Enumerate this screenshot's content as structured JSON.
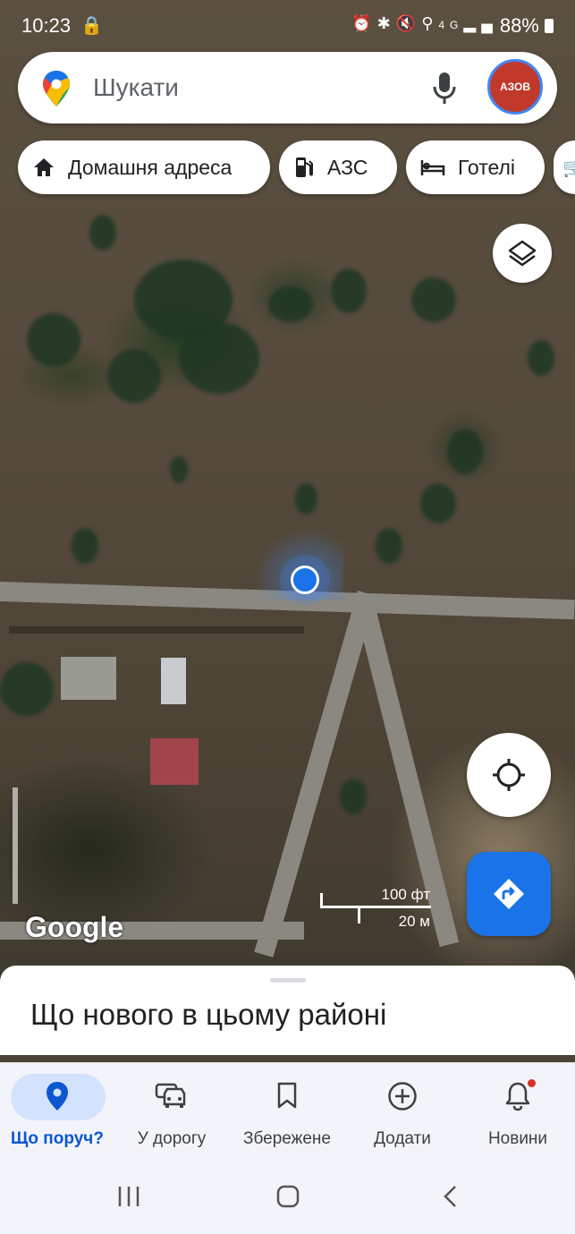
{
  "status_bar": {
    "time": "10:23",
    "battery": "88%",
    "icons": [
      "alarm-icon",
      "bluetooth-icon",
      "mute-icon",
      "location-icon",
      "4g-icon",
      "signal-icon",
      "battery-icon"
    ]
  },
  "search": {
    "placeholder": "Шукати",
    "avatar_text": "АЗОВ"
  },
  "chips": [
    {
      "label": "Домашня адреса",
      "icon": "home-icon"
    },
    {
      "label": "АЗС",
      "icon": "gas-station-icon"
    },
    {
      "label": "Готелі",
      "icon": "hotel-icon"
    }
  ],
  "map": {
    "scale_imperial": "100 фт",
    "scale_metric": "20 м",
    "attribution": "Google"
  },
  "sheet": {
    "title": "Що нового в цьому районі"
  },
  "bottom_nav": [
    {
      "label": "Що поруч?",
      "icon": "place-pin-icon",
      "active": true
    },
    {
      "label": "У дорогу",
      "icon": "car-icon",
      "active": false
    },
    {
      "label": "Збережене",
      "icon": "bookmark-icon",
      "active": false
    },
    {
      "label": "Додати",
      "icon": "add-circle-icon",
      "active": false
    },
    {
      "label": "Новини",
      "icon": "bell-icon",
      "active": false
    }
  ],
  "colors": {
    "accent": "#1a73e8",
    "active_pill": "#d3e3fd",
    "active_label": "#0b57d0"
  }
}
